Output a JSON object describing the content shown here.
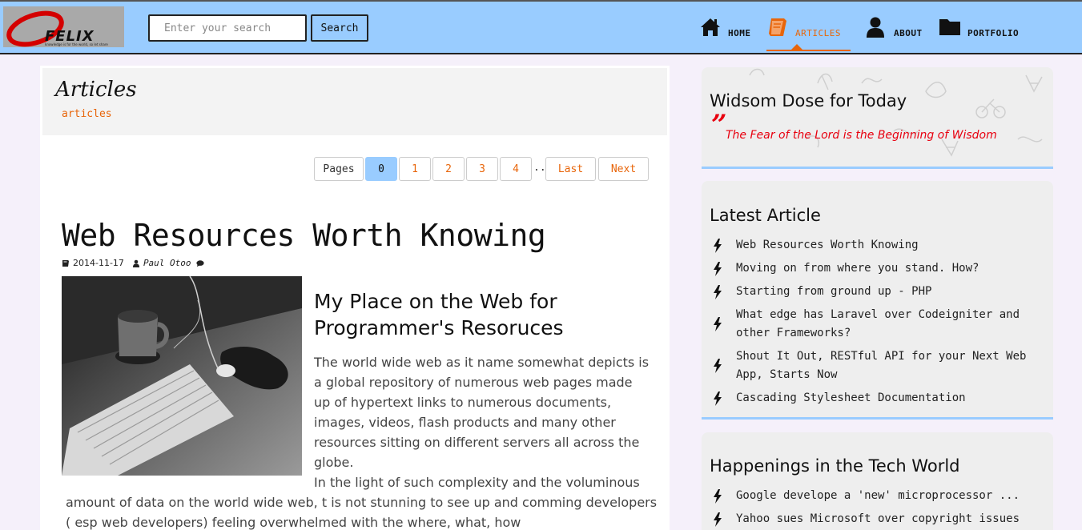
{
  "header": {
    "logo_text": "FELIX",
    "logo_tagline": "knowledge is for the world, so let share",
    "search": {
      "placeholder": "Enter your search",
      "value": ""
    },
    "search_button": "Search",
    "nav": [
      {
        "label": "HOME",
        "icon": "home-icon",
        "active": false
      },
      {
        "label": "ARTICLES",
        "icon": "book-icon",
        "active": true
      },
      {
        "label": "ABOUT",
        "icon": "user-icon",
        "active": false
      },
      {
        "label": "PORTFOLIO",
        "icon": "folder-icon",
        "active": false
      }
    ]
  },
  "colors": {
    "accent": "#e8650a",
    "header_bg": "#99ccff",
    "quote": "#e8000f"
  },
  "page": {
    "title": "Articles",
    "breadcrumb": "articles"
  },
  "pagination": {
    "label": "Pages",
    "pages": [
      "0",
      "1",
      "2",
      "3",
      "4"
    ],
    "current": "0",
    "ellipsis": "...",
    "last": "Last",
    "next": "Next"
  },
  "article": {
    "title": "Web Resources Worth Knowing",
    "date": "2014-11-17",
    "author": "Paul Otoo",
    "subtitle": "My Place on the Web for Programmer's Resoruces",
    "paragraph1": "The world wide web as it name somewhat depicts is  a global repository of numerous web pages made up of hypertext links  to numerous documents,  images, videos, flash products and many other resources sitting on different servers all across the globe.",
    "paragraph2": "In the light of such complexity and the voluminous amount of data on the world wide web, t is not stunning to see up and comming developers ( esp web developers)  feeling overwhelmed with the where, what, how"
  },
  "sidebar": {
    "wisdom": {
      "title": "Widsom Dose for Today",
      "quote_mark": "”",
      "quote": "The Fear of the Lord is the Beginning of Wisdom"
    },
    "latest": {
      "title": "Latest Article",
      "items": [
        "Web Resources Worth Knowing",
        "Moving on from where you stand. How?",
        "Starting from ground up - PHP",
        "What edge has Laravel over Codeigniter and other Frameworks?",
        "Shout It Out, RESTful API for your Next Web App, Starts Now",
        "Cascading Stylesheet Documentation"
      ]
    },
    "tech": {
      "title": "Happenings in the Tech World",
      "items": [
        "Google develope a 'new' microprocessor ...",
        "Yahoo sues Microsoft over copyright issues"
      ]
    }
  }
}
